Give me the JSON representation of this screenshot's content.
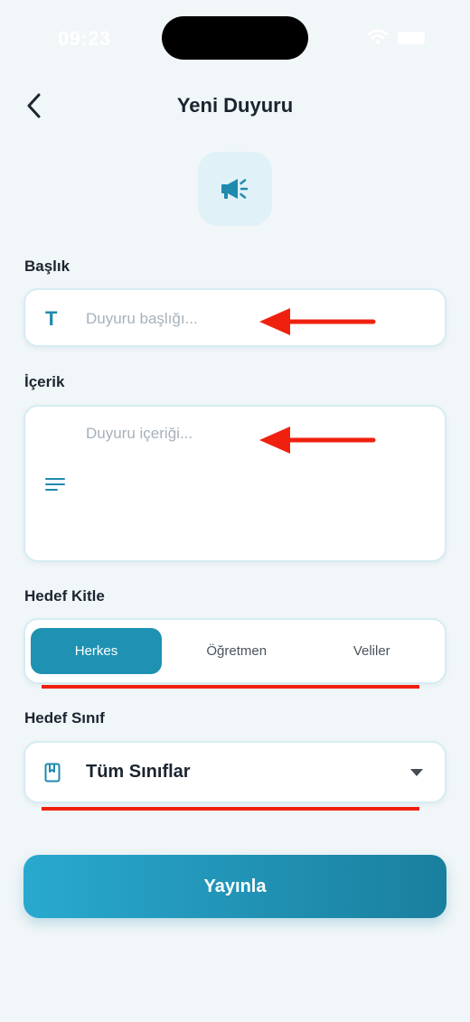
{
  "status_bar": {
    "time": "09:23"
  },
  "header": {
    "title": "Yeni Duyuru",
    "back_icon": "chevron-left-icon"
  },
  "hero": {
    "icon": "megaphone-icon",
    "accent": "#1f8aad",
    "bg": "#e0f1f7"
  },
  "form": {
    "title_label": "Başlık",
    "title_icon_glyph": "T",
    "title_placeholder": "Duyuru başlığı...",
    "title_value": "",
    "content_label": "İçerik",
    "content_icon": "lines-icon",
    "content_placeholder": "Duyuru içeriği...",
    "content_value": "",
    "audience_label": "Hedef Kitle",
    "audience_options": [
      "Herkes",
      "Öğretmen",
      "Veliler"
    ],
    "audience_selected": "Herkes",
    "class_label": "Hedef Sınıf",
    "class_icon": "book-icon",
    "class_value": "Tüm Sınıflar"
  },
  "publish_button": {
    "label": "Yayınla"
  },
  "colors": {
    "accent": "#1f92b3",
    "background": "#f1f6f8",
    "annotation": "#f0200e"
  }
}
